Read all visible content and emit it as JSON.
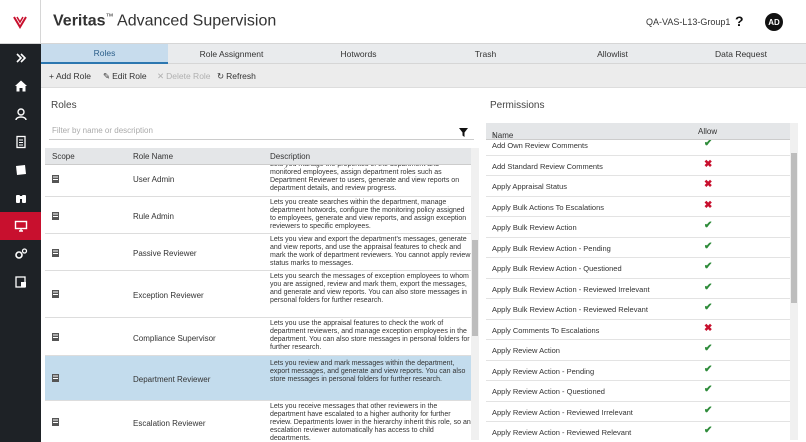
{
  "header": {
    "brand": "Veritas",
    "trademark": "™",
    "product": " Advanced Supervision",
    "user_group": "QA-VAS-L13-Group1",
    "help": "?",
    "avatar_initials": "AD"
  },
  "nav": {
    "items": [
      {
        "icon": "chevrons-right-icon"
      },
      {
        "icon": "home-icon"
      },
      {
        "icon": "user-icon"
      },
      {
        "icon": "document-icon"
      },
      {
        "icon": "folder-icon"
      },
      {
        "icon": "binoculars-icon"
      },
      {
        "icon": "monitor-icon",
        "active": true
      },
      {
        "icon": "gears-icon"
      },
      {
        "icon": "report-icon"
      }
    ],
    "active_color": "#c8102e"
  },
  "tabs": [
    {
      "label": "Roles",
      "active": true
    },
    {
      "label": "Role Assignment"
    },
    {
      "label": "Hotwords"
    },
    {
      "label": "Trash"
    },
    {
      "label": "Allowlist"
    },
    {
      "label": "Data Request"
    }
  ],
  "toolbar": {
    "add": "Add Role",
    "edit": "Edit Role",
    "delete": "Delete Role",
    "refresh": "Refresh"
  },
  "roles": {
    "title": "Roles",
    "filter_placeholder": "Filter by name or description",
    "columns": [
      "Scope",
      "Role Name",
      "Description"
    ],
    "rows": [
      {
        "name": "User Admin",
        "desc": "Lets you manage the properties of the department and monitored employees, assign department roles such as Department Reviewer to users, generate and view reports on department details, and review progress."
      },
      {
        "name": "Rule Admin",
        "desc": "Lets you create searches within the department, manage department hotwords, configure the monitoring policy assigned to employees, generate and view reports, and assign exception reviewers to specific employees."
      },
      {
        "name": "Passive Reviewer",
        "desc": "Lets you view and export the department's messages, generate and view reports, and use the appraisal features to check and mark the work of department reviewers. You cannot apply review status marks to messages."
      },
      {
        "name": "Exception Reviewer",
        "desc": "Lets you search the messages of exception employees to whom you are assigned, review and mark them, export the messages, and generate and view reports. You can also store messages in personal folders for further research."
      },
      {
        "name": "Compliance Supervisor",
        "desc": "Lets you use the appraisal features to check the work of department reviewers, and manage exception employees in the department. You can also store messages in personal folders for further research."
      },
      {
        "name": "Department Reviewer",
        "desc": "Lets you review and mark messages within the department, export messages, and generate and view reports. You can also store messages in personal folders for further research.",
        "selected": true
      },
      {
        "name": "Escalation Reviewer",
        "desc": "Lets you receive messages that other reviewers in the department have escalated to a higher authority for further review. Departments lower in the hierarchy inherit this role, so an escalation reviewer automatically has access to child departments."
      }
    ]
  },
  "permissions": {
    "title": "Permissions",
    "columns": [
      "Name",
      "Allow"
    ],
    "sort_indicator": "↑",
    "allow_yes": "✔",
    "allow_no": "✖",
    "rows": [
      {
        "name": "Add Own Review Comments",
        "allow": true
      },
      {
        "name": "Add Standard Review Comments",
        "allow": false
      },
      {
        "name": "Apply Appraisal Status",
        "allow": false
      },
      {
        "name": "Apply Bulk Actions To Escalations",
        "allow": false
      },
      {
        "name": "Apply Bulk Review Action",
        "allow": true
      },
      {
        "name": "Apply Bulk Review Action - Pending",
        "allow": true
      },
      {
        "name": "Apply Bulk Review Action - Questioned",
        "allow": true
      },
      {
        "name": "Apply Bulk Review Action - Reviewed Irrelevant",
        "allow": true
      },
      {
        "name": "Apply Bulk Review Action - Reviewed Relevant",
        "allow": true
      },
      {
        "name": "Apply Comments To Escalations",
        "allow": false
      },
      {
        "name": "Apply Review Action",
        "allow": true
      },
      {
        "name": "Apply Review Action - Pending",
        "allow": true
      },
      {
        "name": "Apply Review Action - Questioned",
        "allow": true
      },
      {
        "name": "Apply Review Action - Reviewed Irrelevant",
        "allow": true
      },
      {
        "name": "Apply Review Action - Reviewed Relevant",
        "allow": true
      }
    ]
  }
}
